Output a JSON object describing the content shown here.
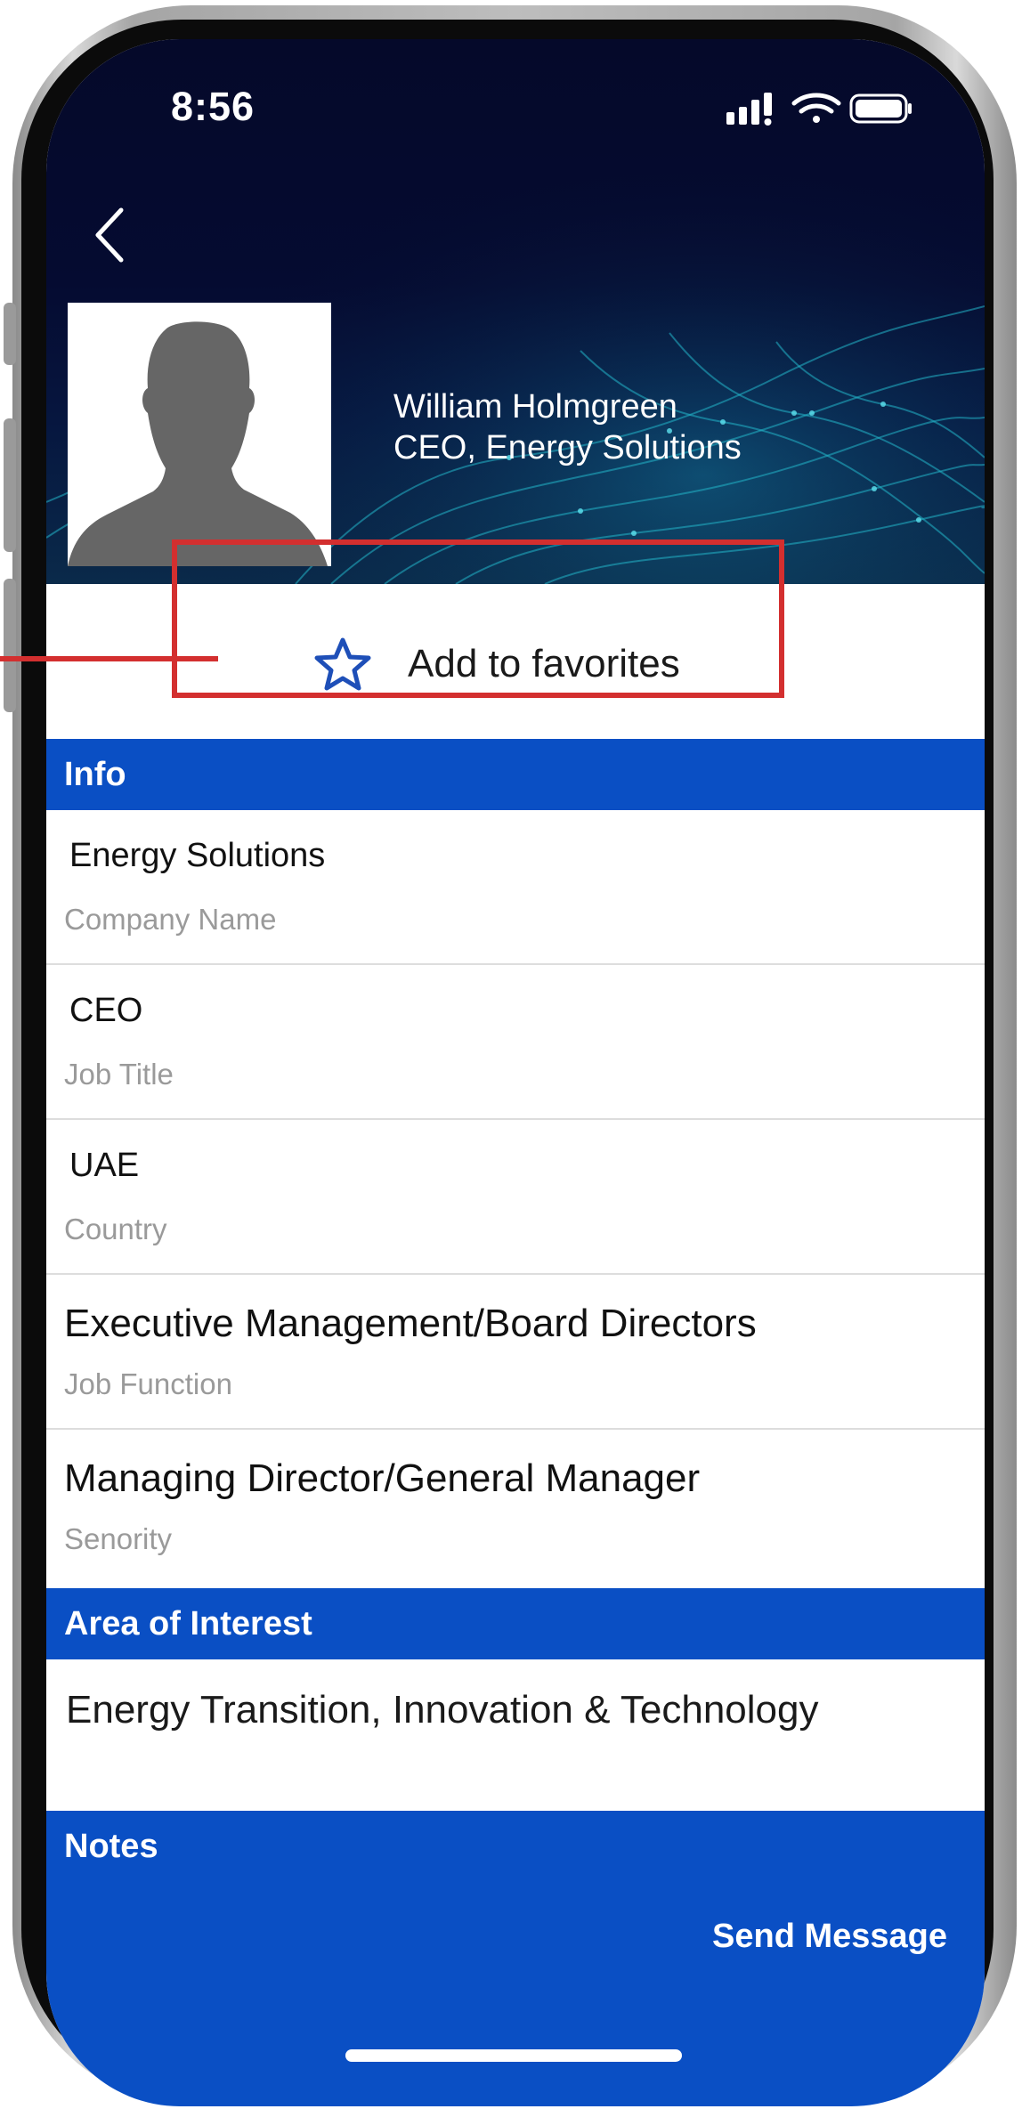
{
  "status_bar": {
    "time": "8:56"
  },
  "profile": {
    "name": "William Holmgreen",
    "headline": "CEO, Energy Solutions"
  },
  "favorites": {
    "label": "Add to favorites"
  },
  "info_section": {
    "title": "Info",
    "rows": [
      {
        "value": "Energy Solutions",
        "label": "Company Name"
      },
      {
        "value": "CEO",
        "label": "Job Title"
      },
      {
        "value": "UAE",
        "label": "Country"
      },
      {
        "value": "Executive Management/Board Directors",
        "label": "Job Function"
      },
      {
        "value": "Managing Director/General Manager",
        "label": "Senority"
      }
    ]
  },
  "interest_section": {
    "title": "Area of Interest",
    "value": "Energy Transition, Innovation & Technology"
  },
  "notes_section": {
    "title": "Notes"
  },
  "footer": {
    "send_label": "Send Message"
  },
  "colors": {
    "header_navy": "#05092a",
    "section_blue": "#0a4fc4",
    "highlight_red": "#d32f2f",
    "star_blue": "#1e4fb8"
  },
  "icons": [
    "back-chevron-icon",
    "signal-icon",
    "wifi-icon",
    "battery-icon",
    "star-icon",
    "person-silhouette-icon"
  ]
}
